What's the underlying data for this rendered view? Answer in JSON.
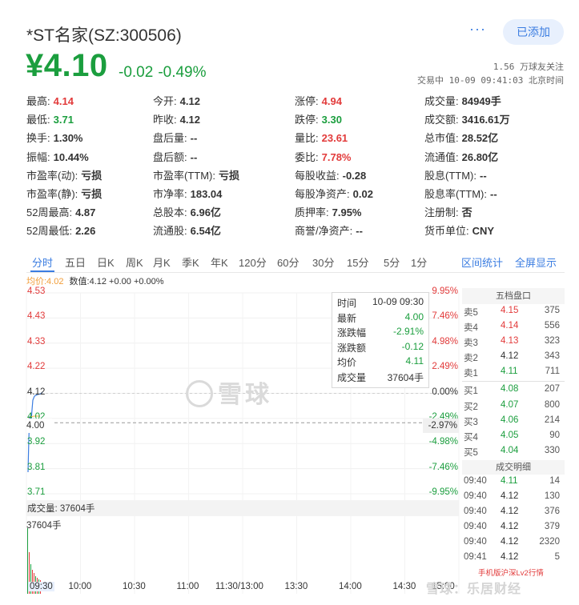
{
  "header": {
    "title": "*ST名家(SZ:300506)",
    "more_label": "···",
    "follow_label": "已添加",
    "price": "¥4.10",
    "change": "-0.02",
    "change_pct": "-0.49%",
    "followers": "1.56 万球友关注",
    "trade_status": "交易中 10-09 09:41:03 北京时间"
  },
  "quote": {
    "rows": [
      [
        {
          "l": "最高:",
          "v": "4.14",
          "c": "red"
        },
        {
          "l": "今开:",
          "v": "4.12",
          "c": ""
        },
        {
          "l": "涨停:",
          "v": "4.94",
          "c": "red"
        },
        {
          "l": "成交量:",
          "v": "84949手",
          "c": ""
        }
      ],
      [
        {
          "l": "最低:",
          "v": "3.71",
          "c": "green"
        },
        {
          "l": "昨收:",
          "v": "4.12",
          "c": ""
        },
        {
          "l": "跌停:",
          "v": "3.30",
          "c": "green"
        },
        {
          "l": "成交额:",
          "v": "3416.61万",
          "c": ""
        }
      ],
      [
        {
          "l": "换手:",
          "v": "1.30%",
          "c": ""
        },
        {
          "l": "盘后量:",
          "v": "--",
          "c": ""
        },
        {
          "l": "量比:",
          "v": "23.61",
          "c": "red"
        },
        {
          "l": "总市值:",
          "v": "28.52亿",
          "c": ""
        }
      ],
      [
        {
          "l": "振幅:",
          "v": "10.44%",
          "c": ""
        },
        {
          "l": "盘后额:",
          "v": "--",
          "c": ""
        },
        {
          "l": "委比:",
          "v": "7.78%",
          "c": "red"
        },
        {
          "l": "流通值:",
          "v": "26.80亿",
          "c": ""
        }
      ],
      [
        {
          "l": "市盈率(动):",
          "v": "亏损",
          "c": ""
        },
        {
          "l": "市盈率(TTM):",
          "v": "亏损",
          "c": ""
        },
        {
          "l": "每股收益:",
          "v": "-0.28",
          "c": ""
        },
        {
          "l": "股息(TTM):",
          "v": "--",
          "c": ""
        }
      ],
      [
        {
          "l": "市盈率(静):",
          "v": "亏损",
          "c": ""
        },
        {
          "l": "市净率:",
          "v": "183.04",
          "c": ""
        },
        {
          "l": "每股净资产:",
          "v": "0.02",
          "c": ""
        },
        {
          "l": "股息率(TTM):",
          "v": "--",
          "c": ""
        }
      ],
      [
        {
          "l": "52周最高:",
          "v": "4.87",
          "c": ""
        },
        {
          "l": "总股本:",
          "v": "6.96亿",
          "c": ""
        },
        {
          "l": "质押率:",
          "v": "7.95%",
          "c": ""
        },
        {
          "l": "注册制:",
          "v": "否",
          "c": ""
        }
      ],
      [
        {
          "l": "52周最低:",
          "v": "2.26",
          "c": ""
        },
        {
          "l": "流通股:",
          "v": "6.54亿",
          "c": ""
        },
        {
          "l": "商誉/净资产:",
          "v": "--",
          "c": ""
        },
        {
          "l": "货币单位:",
          "v": "CNY",
          "c": ""
        }
      ]
    ]
  },
  "tabs": {
    "items": [
      "分时",
      "五日",
      "日K",
      "周K",
      "月K",
      "季K",
      "年K",
      "120分",
      "60分",
      "30分",
      "15分",
      "5分",
      "1分"
    ],
    "range_stats": "区间统计",
    "fullscreen": "全屏显示"
  },
  "chart_info": {
    "avg_label": "均价:4.02",
    "data_label": "数值:4.12 +0.00 +0.00%"
  },
  "chart_data": {
    "type": "line",
    "y_left_ticks": [
      "4.53",
      "4.43",
      "4.33",
      "4.22",
      "4.12",
      "4.02",
      "3.92",
      "3.81",
      "3.71"
    ],
    "y_right_ticks": [
      "9.95%",
      "7.46%",
      "4.98%",
      "2.49%",
      "0.00%",
      "-2.49%",
      "-4.98%",
      "-7.46%",
      "-9.95%"
    ],
    "crosshair_price": "4.00",
    "crosshair_pct": "-2.97%",
    "x_ticks": [
      "09:30",
      "10:00",
      "10:30",
      "11:00",
      "11:30/13:00",
      "13:30",
      "14:00",
      "14:30",
      "15:00"
    ],
    "volume_label": "成交量: 37604手",
    "volume_value": "37604手",
    "ylim": [
      3.71,
      4.53
    ],
    "prev_close": 4.12
  },
  "tooltip": {
    "rows": [
      {
        "l": "时间",
        "v": "10-09 09:30",
        "c": ""
      },
      {
        "l": "最新",
        "v": "4.00",
        "c": "green"
      },
      {
        "l": "涨跌幅",
        "v": "-2.91%",
        "c": "green"
      },
      {
        "l": "涨跌额",
        "v": "-0.12",
        "c": "green"
      },
      {
        "l": "均价",
        "v": "4.11",
        "c": "green"
      },
      {
        "l": "成交量",
        "v": "37604手",
        "c": ""
      }
    ]
  },
  "order_book": {
    "title": "五档盘口",
    "asks": [
      {
        "k": "卖5",
        "p": "4.15",
        "v": "375",
        "c": "red"
      },
      {
        "k": "卖4",
        "p": "4.14",
        "v": "556",
        "c": "red"
      },
      {
        "k": "卖3",
        "p": "4.13",
        "v": "323",
        "c": "red"
      },
      {
        "k": "卖2",
        "p": "4.12",
        "v": "343",
        "c": "dark"
      },
      {
        "k": "卖1",
        "p": "4.11",
        "v": "711",
        "c": "green"
      }
    ],
    "bids": [
      {
        "k": "买1",
        "p": "4.08",
        "v": "207",
        "c": "green"
      },
      {
        "k": "买2",
        "p": "4.07",
        "v": "800",
        "c": "green"
      },
      {
        "k": "买3",
        "p": "4.06",
        "v": "214",
        "c": "green"
      },
      {
        "k": "买4",
        "p": "4.05",
        "v": "90",
        "c": "green"
      },
      {
        "k": "买5",
        "p": "4.04",
        "v": "330",
        "c": "green"
      }
    ],
    "trades_title": "成交明细",
    "trades": [
      {
        "t": "09:40",
        "p": "4.11",
        "v": "14",
        "pc": "green",
        "vc": "green"
      },
      {
        "t": "09:40",
        "p": "4.12",
        "v": "130",
        "pc": "dark",
        "vc": "red"
      },
      {
        "t": "09:40",
        "p": "4.12",
        "v": "376",
        "pc": "dark",
        "vc": "red"
      },
      {
        "t": "09:40",
        "p": "4.12",
        "v": "379",
        "pc": "dark",
        "vc": "red"
      },
      {
        "t": "09:40",
        "p": "4.12",
        "v": "2320",
        "pc": "dark",
        "vc": "red"
      },
      {
        "t": "09:41",
        "p": "4.12",
        "v": "5",
        "pc": "dark",
        "vc": "red"
      }
    ],
    "footer": "手机版沪深Lv2行情"
  },
  "watermark": {
    "center": "雪球",
    "bottom": "雪球：乐居财经"
  }
}
